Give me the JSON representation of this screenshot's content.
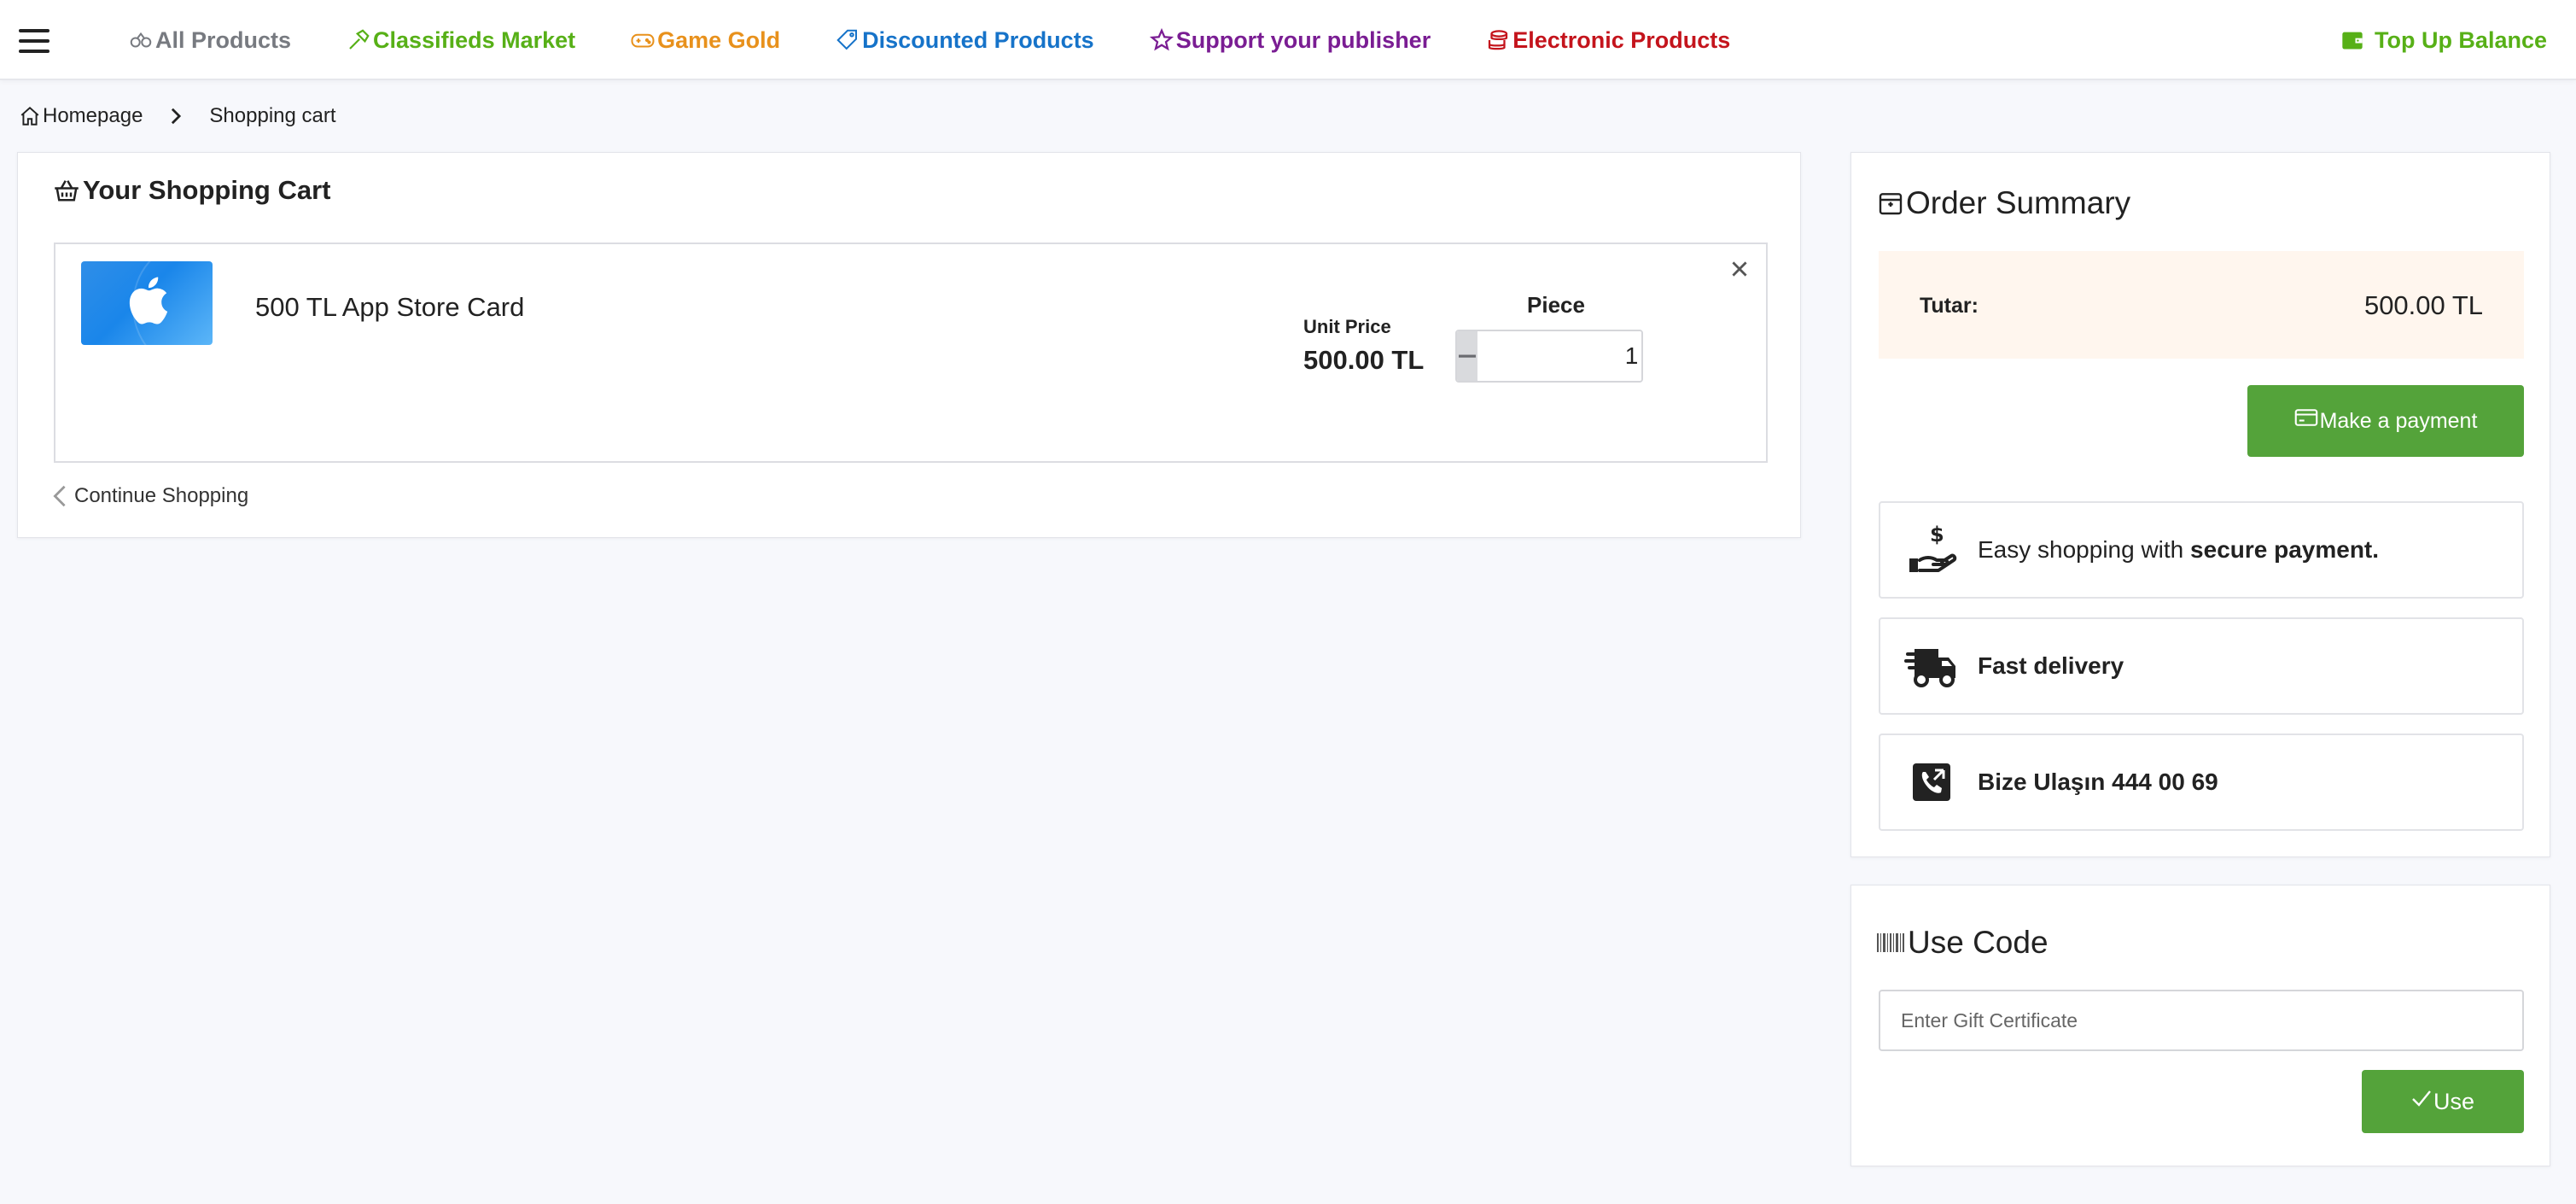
{
  "nav": {
    "menu_icon": "hamburger-menu-icon",
    "links": [
      {
        "label": "All Products",
        "icon": "gamepad-icon",
        "color": "#777a80"
      },
      {
        "label": "Classifieds Market",
        "icon": "hammer-icon",
        "color": "#57b017"
      },
      {
        "label": "Game Gold",
        "icon": "controller-icon",
        "color": "#e8911c"
      },
      {
        "label": "Discounted Products",
        "icon": "tag-icon",
        "color": "#1673c9"
      },
      {
        "label": "Support your publisher",
        "icon": "star-icon",
        "color": "#7a1d93"
      },
      {
        "label": "Electronic Products",
        "icon": "coins-icon",
        "color": "#c4141c"
      }
    ],
    "top_up": {
      "label": "Top Up Balance",
      "icon": "wallet-icon",
      "color": "#57b017"
    }
  },
  "breadcrumb": {
    "home": "Homepage",
    "current": "Shopping cart"
  },
  "cart": {
    "title": "Your Shopping Cart",
    "item": {
      "name": "500 TL App Store Card",
      "image_icon": "apple-logo-icon",
      "unit_price_label": "Unit Price",
      "unit_price": "500.00 TL",
      "piece_label": "Piece",
      "quantity": "1"
    },
    "continue": "Continue Shopping"
  },
  "summary": {
    "title": "Order Summary",
    "total_label": "Tutar:",
    "total_value": "500.00 TL",
    "pay_button": "Make a payment",
    "features": [
      {
        "text_prefix": "Easy shopping with ",
        "text_bold": "secure payment.",
        "icon": "hand-dollar-icon"
      },
      {
        "text": "Fast delivery",
        "icon": "truck-icon"
      },
      {
        "text": "Bize Ulaşın 444 00 69",
        "icon": "phone-icon"
      }
    ],
    "accent": "#54a33a",
    "total_bg": "#fff6ee"
  },
  "use_code": {
    "title": "Use Code",
    "placeholder": "Enter Gift Certificate",
    "button": "Use"
  }
}
